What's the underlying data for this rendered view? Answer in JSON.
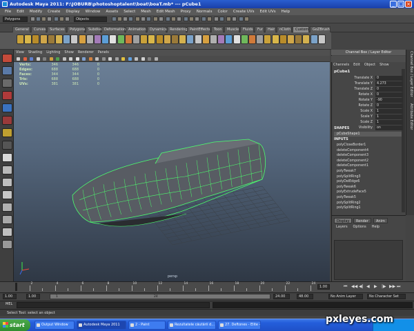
{
  "window": {
    "title": "Autodesk Maya 2011: F:\\JOBURB\\photoshoptalent\\boat\\boaT.mb* --- pCube1",
    "min": "_",
    "max": "□",
    "close": "×"
  },
  "menus": [
    "File",
    "Edit",
    "Modify",
    "Create",
    "Display",
    "Window",
    "Assets",
    "Select",
    "Mesh",
    "Edit Mesh",
    "Proxy",
    "Normals",
    "Color",
    "Create UVs",
    "Edit UVs",
    "Help"
  ],
  "status_line": {
    "mode": "Polygons",
    "objects": "Objects"
  },
  "shelf_tabs": [
    "General",
    "Curves",
    "Surfaces",
    "Polygons",
    "Subdivs",
    "Deformation",
    "Animation",
    "Dynamics",
    "Rendering",
    "PaintEffects",
    "Toon",
    "Muscle",
    "Fluids",
    "Fur",
    "Hair",
    "nCloth",
    "Custom",
    "GoZBrush"
  ],
  "active_shelf_tab": "Custom",
  "viewport": {
    "menu": [
      "View",
      "Shading",
      "Lighting",
      "Show",
      "Renderer",
      "Panels"
    ],
    "hud": [
      {
        "label": "Verts:",
        "a": "346",
        "b": "346",
        "c": "0"
      },
      {
        "label": "Edges:",
        "a": "688",
        "b": "688",
        "c": "0"
      },
      {
        "label": "Faces:",
        "a": "344",
        "b": "344",
        "c": "0"
      },
      {
        "label": "Tris:",
        "a": "688",
        "b": "688",
        "c": "0"
      },
      {
        "label": "UVs:",
        "a": "381",
        "b": "381",
        "c": "0"
      }
    ],
    "camera_label": "persp"
  },
  "channel_box": {
    "title": "Channel Box / Layer Editor",
    "menu": [
      "Channels",
      "Edit",
      "Object",
      "Show"
    ],
    "object": "pCube1",
    "attributes": [
      {
        "name": "Translate X",
        "value": "0"
      },
      {
        "name": "Translate Y",
        "value": "4.273"
      },
      {
        "name": "Translate Z",
        "value": "0"
      },
      {
        "name": "Rotate X",
        "value": "0"
      },
      {
        "name": "Rotate Y",
        "value": "-90"
      },
      {
        "name": "Rotate Z",
        "value": "0"
      },
      {
        "name": "Scale X",
        "value": "1"
      },
      {
        "name": "Scale Y",
        "value": "1"
      },
      {
        "name": "Scale Z",
        "value": "1"
      },
      {
        "name": "Visibility",
        "value": "on"
      }
    ],
    "shapes_header": "SHAPES",
    "shape": "pCubeShape1",
    "inputs_header": "INPUTS",
    "inputs": [
      "polyCloseBorder1",
      "deleteComponent4",
      "deleteComponent3",
      "deleteComponent2",
      "deleteComponent1",
      "polyTweak7",
      "polySplitRing3",
      "polyDelEdge6",
      "polyTweak6",
      "polyExtrudeFace5",
      "polyTweak5",
      "polySplitRing2",
      "polySplitRing1"
    ]
  },
  "side_tabs": [
    "Channel Box / Layer Editor",
    "Attribute Editor"
  ],
  "layer_editor": {
    "tabs": [
      "Display",
      "Render",
      "Anim"
    ],
    "menu": [
      "Layers",
      "Options",
      "Help"
    ]
  },
  "time_slider": {
    "ticks": [
      "2",
      "4",
      "6",
      "8",
      "10",
      "12",
      "14",
      "16",
      "18",
      "20",
      "22",
      "24"
    ],
    "current": "1.00"
  },
  "range_slider": {
    "start": "1.00",
    "inner_start": "1.00",
    "frame": "1",
    "inner_end": "24",
    "end_a": "24.00",
    "end_b": "48.00",
    "anim_layer": "No Anim Layer",
    "char_set": "No Character Set"
  },
  "mel_label": "MEL",
  "help_line": "Select Tool: select an object",
  "taskbar": {
    "start": "start",
    "tasks": [
      "Output Window",
      "Autodesk Maya 2011",
      "2 - Paint",
      "Rezultatele căutării d...",
      "27. Deftones - Elite -..."
    ]
  },
  "watermark": "pxleyes.com",
  "colors": {
    "wire": "#4dff6e",
    "accent": "#2a5fd0",
    "viewport_top": "#6b7f96",
    "viewport_bottom": "#2f3845"
  }
}
